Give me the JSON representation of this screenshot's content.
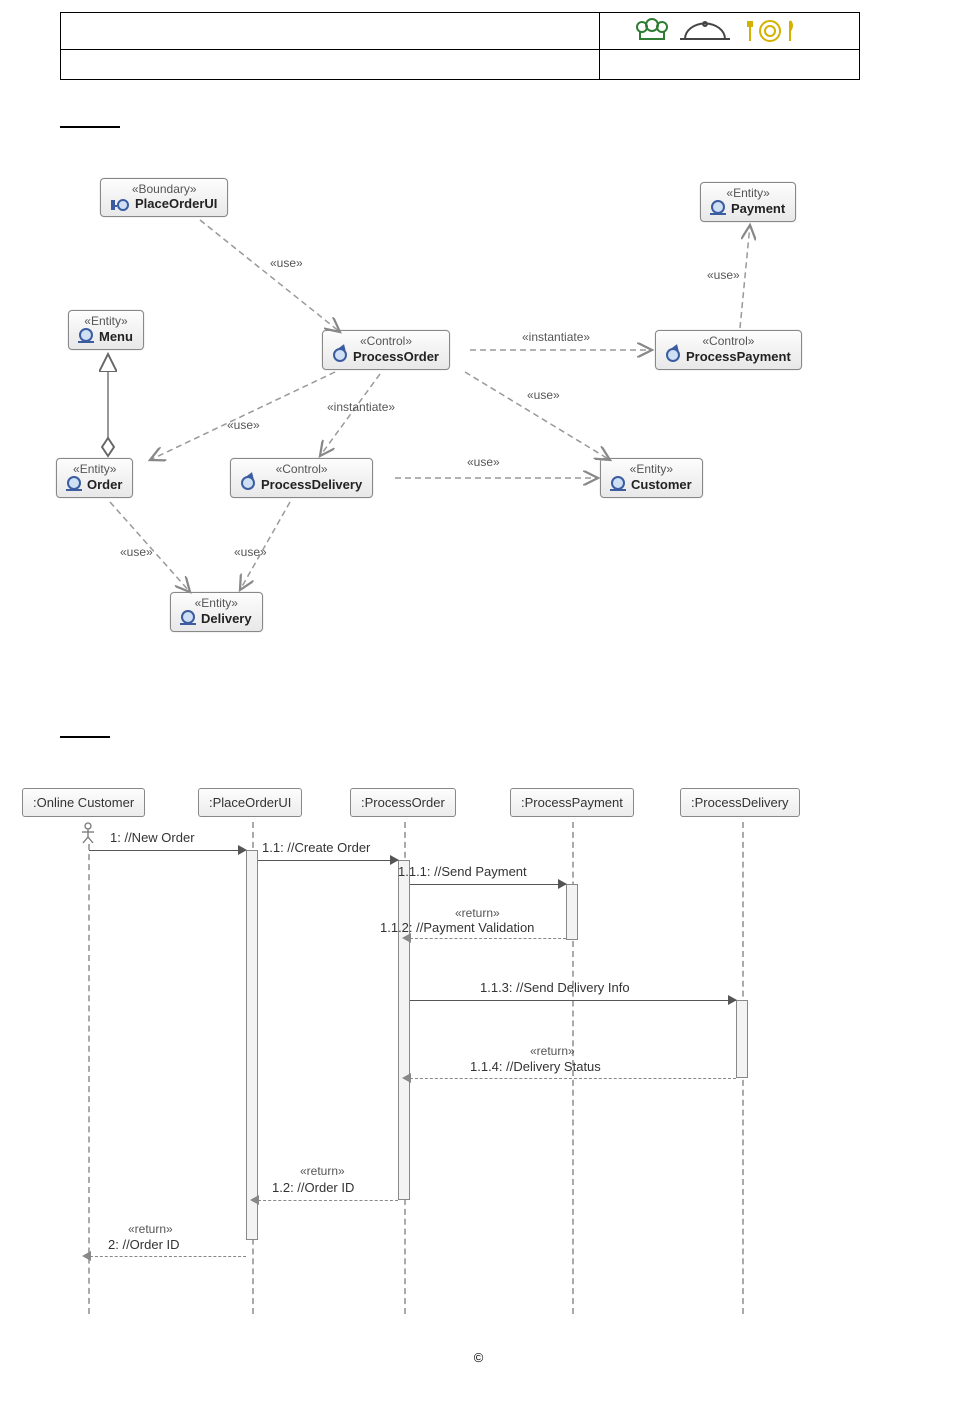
{
  "header": {
    "row1_left": "",
    "row1_right_logo": "chef-cloche-cutlery-logo",
    "row2_left": "",
    "row2_right": ""
  },
  "section_labels": {
    "class": "",
    "sequence": ""
  },
  "class_diagram": {
    "nodes": {
      "placeOrderUI": {
        "stereotype": "«Boundary»",
        "name": "PlaceOrderUI"
      },
      "payment": {
        "stereotype": "«Entity»",
        "name": "Payment"
      },
      "menu": {
        "stereotype": "«Entity»",
        "name": "Menu"
      },
      "processOrder": {
        "stereotype": "«Control»",
        "name": "ProcessOrder"
      },
      "processPayment": {
        "stereotype": "«Control»",
        "name": "ProcessPayment"
      },
      "order": {
        "stereotype": "«Entity»",
        "name": "Order"
      },
      "processDelivery": {
        "stereotype": "«Control»",
        "name": "ProcessDelivery"
      },
      "customer": {
        "stereotype": "«Entity»",
        "name": "Customer"
      },
      "delivery": {
        "stereotype": "«Entity»",
        "name": "Delivery"
      }
    },
    "labels": {
      "use": "«use»",
      "instantiate": "«instantiate»"
    }
  },
  "sequence_diagram": {
    "participants": {
      "p1": ":Online Customer",
      "p2": ":PlaceOrderUI",
      "p3": ":ProcessOrder",
      "p4": ":ProcessPayment",
      "p5": ":ProcessDelivery"
    },
    "messages": {
      "m1": "1: //New Order",
      "m11": "1.1: //Create Order",
      "m111": "1.1.1: //Send Payment",
      "r111": "«return»",
      "m112": "1.1.2: //Payment Validation",
      "m113": "1.1.3: //Send Delivery Info",
      "r113": "«return»",
      "m114": "1.1.4: //Delivery Status",
      "r12": "«return»",
      "m12": "1.2: //Order ID",
      "r2": "«return»",
      "m2": "2: //Order ID"
    }
  },
  "footer": {
    "copyright": "©"
  }
}
